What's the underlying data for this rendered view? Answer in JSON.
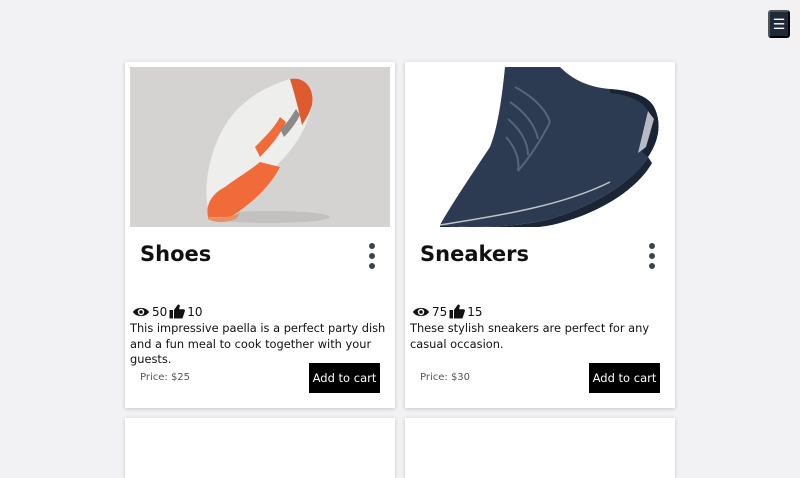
{
  "header": {
    "menu_icon": "hamburger-icon",
    "menu_glyph": "☰"
  },
  "products": [
    {
      "title": "Shoes",
      "views": "50",
      "likes": "10",
      "description": "This impressive paella is a perfect party dish and a fun meal to cook together with your guests.",
      "price": "Price: $25",
      "cart_label": "Add to cart",
      "image": "white-orange-running-shoe"
    },
    {
      "title": "Sneakers",
      "views": "75",
      "likes": "15",
      "description": "These stylish sneakers are perfect for any casual occasion.",
      "price": "Price: $30",
      "cart_label": "Add to cart",
      "image": "navy-knit-sneaker"
    }
  ],
  "colors": {
    "menu_bg": "#1f2a38",
    "button_bg": "#000000",
    "page_bg": "#f2f2f4"
  }
}
